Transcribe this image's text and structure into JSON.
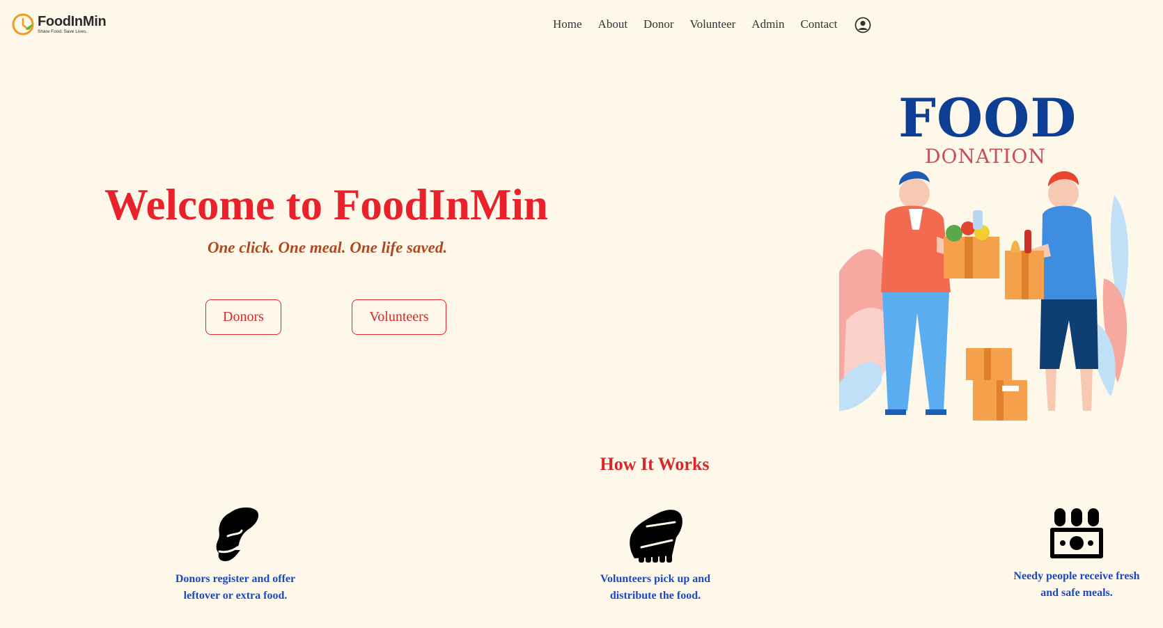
{
  "brand": {
    "name": "FoodInMin",
    "tagline": "Share Food. Save Lives."
  },
  "nav": {
    "items": [
      "Home",
      "About",
      "Donor",
      "Volunteer",
      "Admin",
      "Contact"
    ],
    "user_icon": "user-circle-icon"
  },
  "hero": {
    "title": "Welcome to FoodInMin",
    "tagline": "One click. One meal. One life saved.",
    "buttons": {
      "donors": "Donors",
      "volunteers": "Volunteers"
    },
    "illustration": {
      "title": "FOOD",
      "subtitle": "DONATION"
    }
  },
  "how": {
    "title": "How It Works",
    "steps": [
      {
        "icon": "heart-hand-icon",
        "text_line1": "Donors register and offer",
        "text_line2": "leftover or extra food."
      },
      {
        "icon": "helping-hands-icon",
        "text_line1": "Volunteers pick up and",
        "text_line2": "distribute the food."
      },
      {
        "icon": "people-money-icon",
        "text_line1": "Needy people receive fresh",
        "text_line2": "and safe meals."
      }
    ]
  },
  "colors": {
    "background": "#fef8ea",
    "accent_red": "#e8212a",
    "tagline_brown": "#b1461f",
    "step_blue": "#1a49c8",
    "food_blue": "#0e3e94"
  }
}
